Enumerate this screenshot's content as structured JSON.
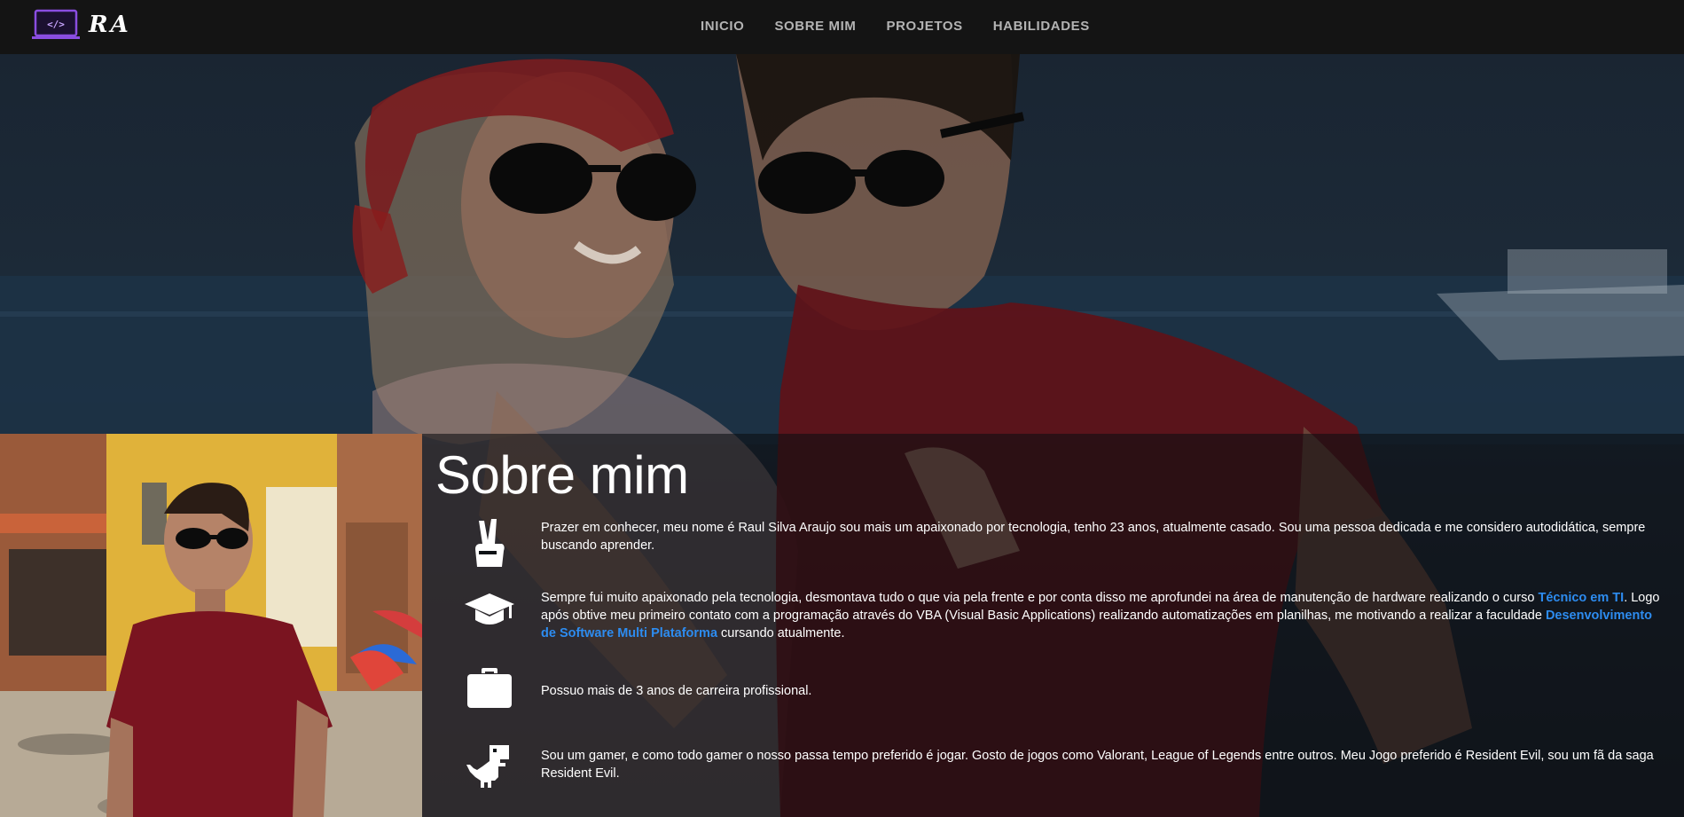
{
  "nav": {
    "logo_text": "RA",
    "logo_code": "</>",
    "links": [
      "INICIO",
      "SOBRE MIM",
      "PROJETOS",
      "HABILIDADES"
    ]
  },
  "about": {
    "title": "Sobre mim",
    "items": [
      {
        "icon": "peace-hand-icon",
        "text": "Prazer em conhecer, meu nome é Raul Silva Araujo sou mais um apaixonado por tecnologia, tenho 23 anos, atualmente casado. Sou uma pessoa dedicada e me considero autodidática, sempre buscando aprender."
      },
      {
        "icon": "graduation-cap-icon",
        "text_part1": "Sempre fui muito apaixonado pela tecnologia, desmontava tudo o que via pela frente e por conta disso me aprofundei na área de manutenção de hardware realizando o curso ",
        "link1": "Técnico em TI",
        "text_part2": ". Logo após obtive meu primeiro contato com a programação através do VBA (Visual Basic Applications) realizando automatizações em planilhas, me motivando a realizar a faculdade ",
        "link2": "Desenvolvimento de Software Multi Plataforma",
        "text_part3": " cursando atualmente."
      },
      {
        "icon": "briefcase-icon",
        "text": "Possuo mais de 3 anos de carreira profissional."
      },
      {
        "icon": "dinosaur-icon",
        "text": "Sou um gamer, e como todo gamer o nosso passa tempo preferido é jogar. Gosto de jogos como Valorant, League of Legends entre outros. Meu Jogo preferido é Resident Evil, sou um fã da saga Resident Evil."
      }
    ]
  },
  "colors": {
    "navbar_bg": "#141414",
    "nav_text": "#b3b3b3",
    "link_accent": "#2d8cf0",
    "logo_accent": "#8a4de0"
  }
}
